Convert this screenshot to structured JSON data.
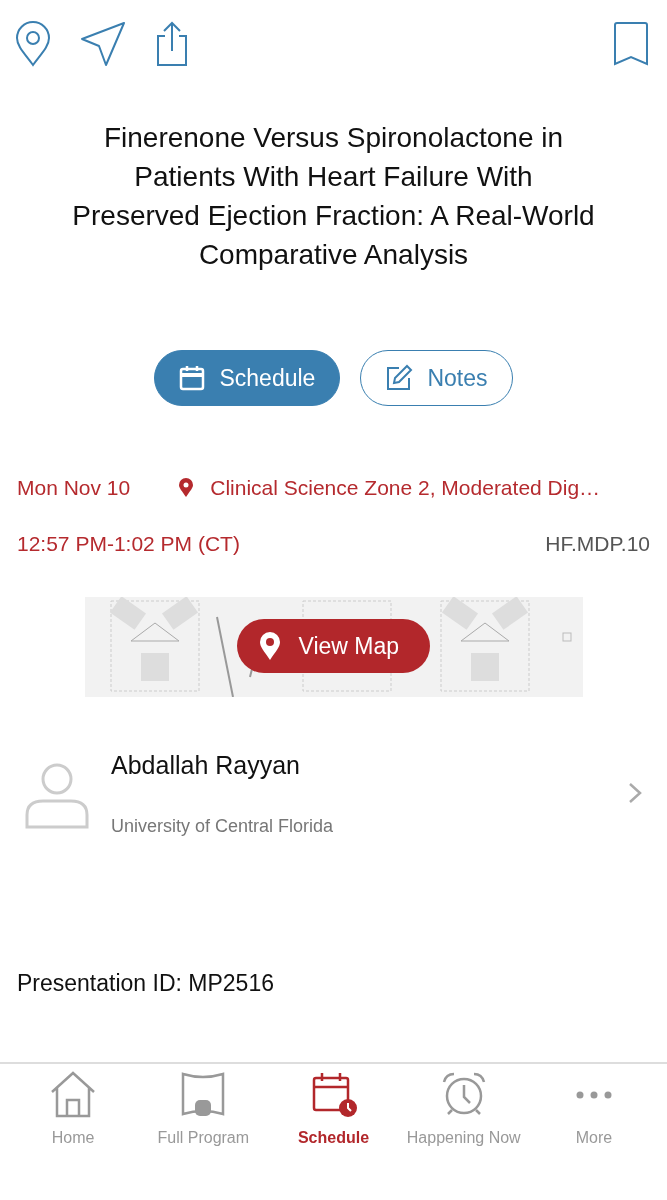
{
  "title": "Finerenone Versus Spironolactone in Patients With Heart Failure With Preserved Ejection Fraction: A Real-World Comparative Analysis",
  "actions": [
    {
      "label": "Schedule",
      "kind": "filled"
    },
    {
      "label": "Notes",
      "kind": "outline"
    }
  ],
  "session": {
    "date": "Mon Nov 10",
    "location": "Clinical Science Zone 2, Moderated Dig…",
    "time": "12:57 PM-1:02 PM (CT)",
    "code": "HF.MDP.10"
  },
  "map": {
    "button": "View Map"
  },
  "speaker": {
    "name": "Abdallah Rayyan",
    "affiliation": "University of Central Florida"
  },
  "presentation_id": {
    "label": "Presentation ID:",
    "value": "MP2516"
  },
  "tabs": [
    {
      "label": "Home",
      "kind": "home",
      "selected": false
    },
    {
      "label": "Full Program",
      "kind": "program",
      "selected": false
    },
    {
      "label": "Schedule",
      "kind": "schedule",
      "selected": true
    },
    {
      "label": "Happening Now",
      "kind": "clock",
      "selected": false
    },
    {
      "label": "More",
      "kind": "more",
      "selected": false
    }
  ]
}
